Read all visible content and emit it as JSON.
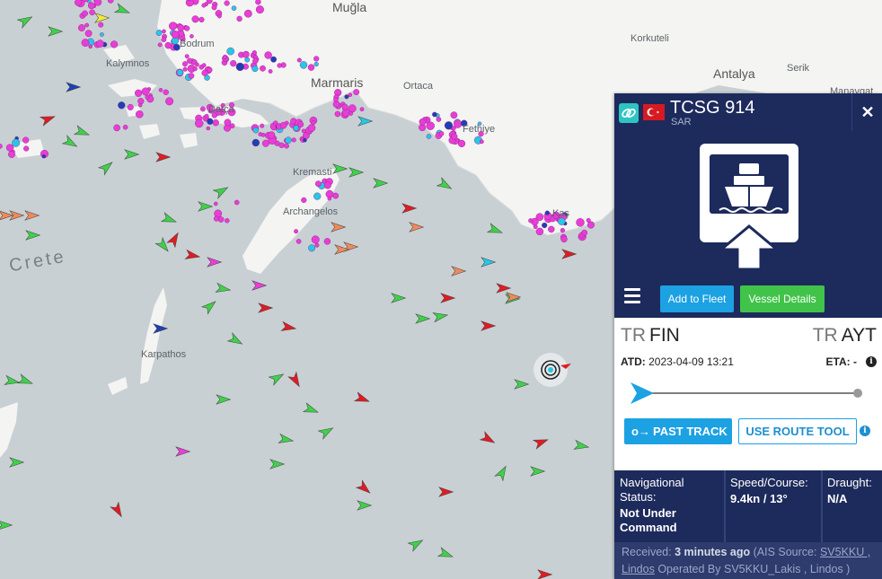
{
  "map": {
    "labels": {
      "mugla": "Muğla",
      "korkuteli": "Korkuteli",
      "antalya": "Antalya",
      "serik": "Serik",
      "bodrum": "Bodrum",
      "marmaris": "Marmaris",
      "ortaca": "Ortaca",
      "datca": "Datça",
      "fethiye": "Fethiye",
      "kas": "Kaş",
      "crete": "Crete",
      "archangelos": "Archangelos",
      "kremasti": "Kremasti",
      "karpathos": "Karpathos",
      "kalymnos": "Kalymnos",
      "manavgat": "Manavgat"
    },
    "colors": {
      "sea": "#c9d0d4",
      "land": "#f4f4f2",
      "passenger": "#e63ed6",
      "cargo": "#3fd14a",
      "tanker": "#e11b22",
      "fishing": "#ee8a5c",
      "highspeed": "#f5e83c",
      "tug": "#27c7e6",
      "unspecified": "#1f3fb3"
    },
    "selected_vessel_icon": "selected-vessel-target-icon"
  },
  "panel": {
    "header": {
      "link_icon": "link-icon",
      "flag": "turkey-flag-icon",
      "name": "TCSG 914",
      "type": "SAR",
      "close": "✕"
    },
    "hero": {
      "icon": "ship-sign-icon"
    },
    "actions": {
      "menu_icon": "hamburger-menu-icon",
      "add_to_fleet": "Add to Fleet",
      "vessel_details": "Vessel Details"
    },
    "route": {
      "from_cc": "TR",
      "from": "FIN",
      "to_cc": "TR",
      "to": "AYT",
      "atd_label": "ATD:",
      "atd_value": "2023-04-09 13:21",
      "eta_label": "ETA:",
      "eta_value": "-",
      "progress": 0.0,
      "colors": {
        "start": "#1ca1e3",
        "end": "#999999"
      }
    },
    "tools": {
      "past_track_icon": "o→",
      "past_track": "PAST TRACK",
      "route_tool": "USE ROUTE TOOL"
    },
    "status": {
      "nav_label": "Navigational Status:",
      "nav_value": "Not Under Command",
      "speed_label": "Speed/Course:",
      "speed_value": "9.4kn / 13°",
      "draught_label": "Draught:",
      "draught_value": "N/A"
    },
    "received": {
      "prefix": "Received:",
      "time": "3 minutes ago",
      "source_prefix": "(AIS Source:",
      "source_link": "SV5KKU , Lindos",
      "operated": "Operated By SV5KKU_Lakis , Lindos )"
    }
  }
}
